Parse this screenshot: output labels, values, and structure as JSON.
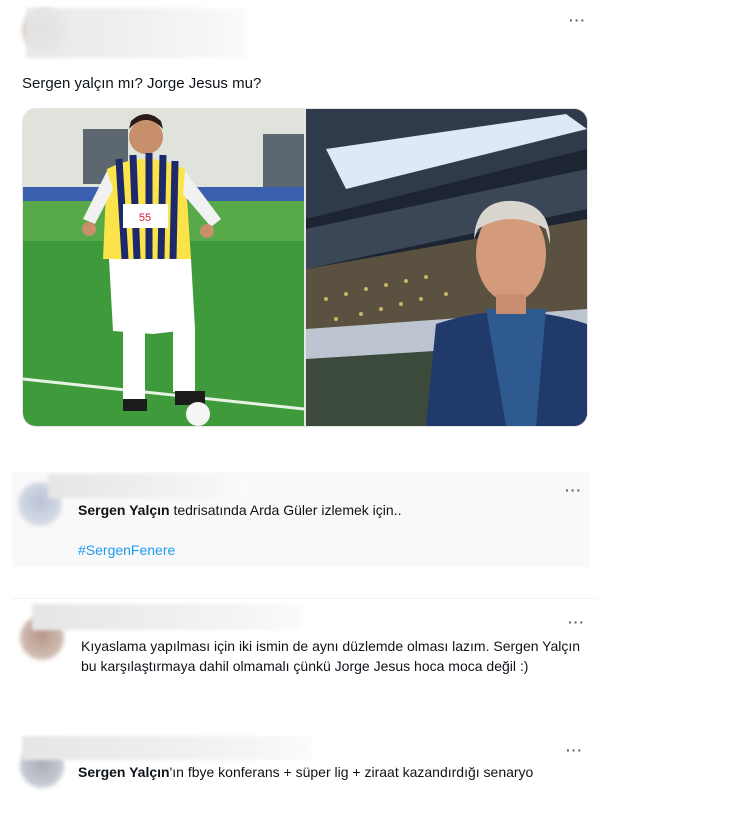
{
  "post": {
    "question": "Sergen yalçın mı? Jorge Jesus mu?",
    "more": "···",
    "images": [
      {
        "alt": "Sergen Yalçın Fenerbahçe formasıyla"
      },
      {
        "alt": "Jorge Jesus stadyumda"
      }
    ],
    "jersey_text": "55"
  },
  "replies": [
    {
      "more": "···",
      "name_bold": "Sergen Yalçın",
      "text": " tedrisatında Arda Güler izlemek için..",
      "hashtag": "#SergenFenere"
    },
    {
      "more": "···",
      "text": "Kıyaslama yapılması için iki ismin de aynı düzlemde olması lazım. Sergen Yalçın bu karşılaştırmaya dahil olmamalı çünkü Jorge Jesus hoca moca değil :)"
    },
    {
      "more": "···",
      "name_bold": "Sergen Yalçın",
      "text": "'ın fbye konferans + süper lig + ziraat kazandırdığı senaryo"
    }
  ],
  "colors": {
    "link": "#1d9bf0",
    "text": "#0f1419",
    "muted": "#536471"
  }
}
